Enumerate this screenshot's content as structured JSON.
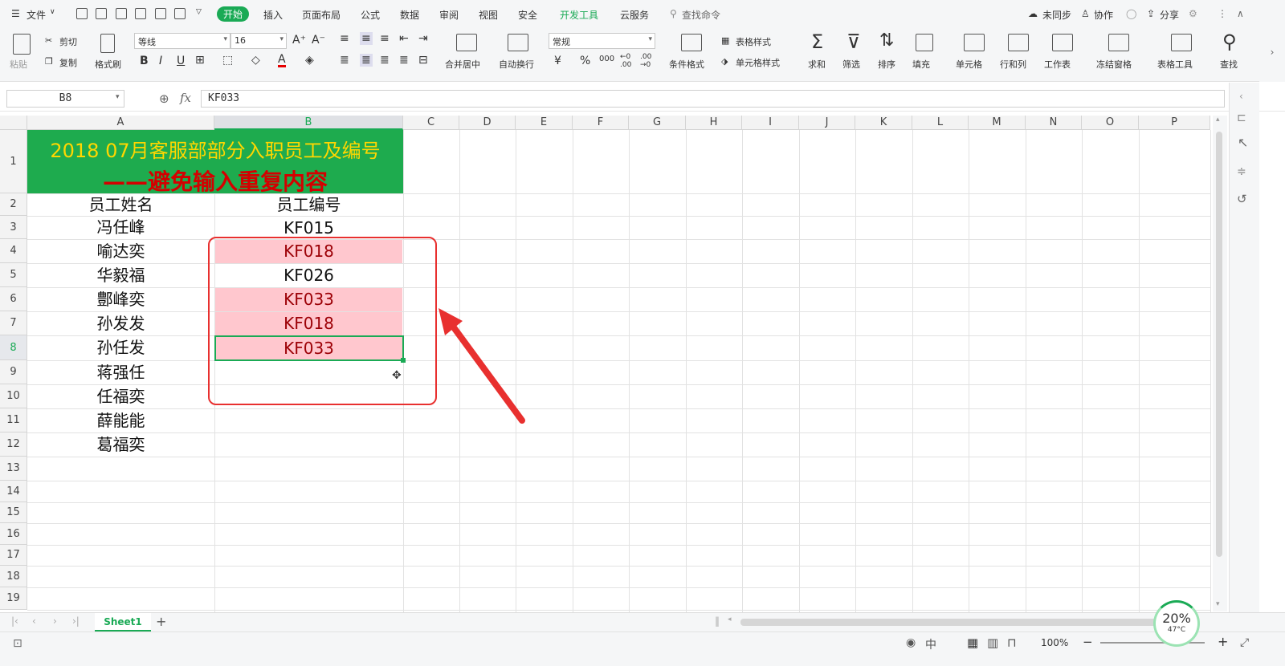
{
  "menubar": {
    "file": "文件",
    "tabs": [
      "开始",
      "插入",
      "页面布局",
      "公式",
      "数据",
      "审阅",
      "视图",
      "安全",
      "开发工具",
      "云服务"
    ],
    "active_tab": "开始",
    "search": "查找命令",
    "right": [
      "未同步",
      "协作",
      "分享"
    ]
  },
  "ribbon": {
    "paste": "粘贴",
    "cut": "剪切",
    "copy": "复制",
    "format_painter": "格式刷",
    "font_name": "等线",
    "font_size": "16",
    "merge": "合并居中",
    "wrap": "自动换行",
    "number_format": "常规",
    "cond_format": "条件格式",
    "table_style": "表格样式",
    "cell_style": "单元格样式",
    "sum": "求和",
    "filter": "筛选",
    "sort": "排序",
    "fill": "填充",
    "cell": "单元格",
    "rowcol": "行和列",
    "sheet": "工作表",
    "freeze": "冻结窗格",
    "table_tools": "表格工具",
    "find": "查找"
  },
  "formula_bar": {
    "name_box": "B8",
    "fx": "fx",
    "value": "KF033"
  },
  "columns": [
    "A",
    "B",
    "C",
    "D",
    "E",
    "F",
    "G",
    "H",
    "I",
    "J",
    "K",
    "L",
    "M",
    "N",
    "O",
    "P"
  ],
  "selected_column": "B",
  "rows": [
    "1",
    "2",
    "3",
    "4",
    "5",
    "6",
    "7",
    "8",
    "9",
    "10",
    "11",
    "12",
    "13",
    "14",
    "15",
    "16",
    "17",
    "18",
    "19"
  ],
  "selected_row": "8",
  "title_line1": "2018 07月客服部部分入职员工及编号",
  "title_line2": "——避免输入重复内容",
  "header": {
    "name": "员工姓名",
    "id": "员工编号"
  },
  "employees": [
    {
      "name": "冯任峰",
      "id": "KF015",
      "dup": false
    },
    {
      "name": "喻达奕",
      "id": "KF018",
      "dup": true
    },
    {
      "name": "华毅福",
      "id": "KF026",
      "dup": false
    },
    {
      "name": "鄷峰奕",
      "id": "KF033",
      "dup": true
    },
    {
      "name": "孙发发",
      "id": "KF018",
      "dup": true
    },
    {
      "name": "孙任发",
      "id": "KF033",
      "dup": true
    },
    {
      "name": "蒋强任",
      "id": "",
      "dup": false
    },
    {
      "name": "任福奕",
      "id": "",
      "dup": false
    },
    {
      "name": "薛能能",
      "id": "",
      "dup": false
    },
    {
      "name": "葛福奕",
      "id": "",
      "dup": false
    }
  ],
  "sheet_tab": "Sheet1",
  "status": {
    "zoom": "100%",
    "perf": "20%",
    "temp": "47°C"
  },
  "colors": {
    "title_bg": "#1eab4e",
    "title1": "#ffd700",
    "title2": "#d40000",
    "dup_bg": "#ffc7ce",
    "dup_fg": "#9c0006",
    "accent": "#1aaa55",
    "annot": "#e8302f"
  }
}
